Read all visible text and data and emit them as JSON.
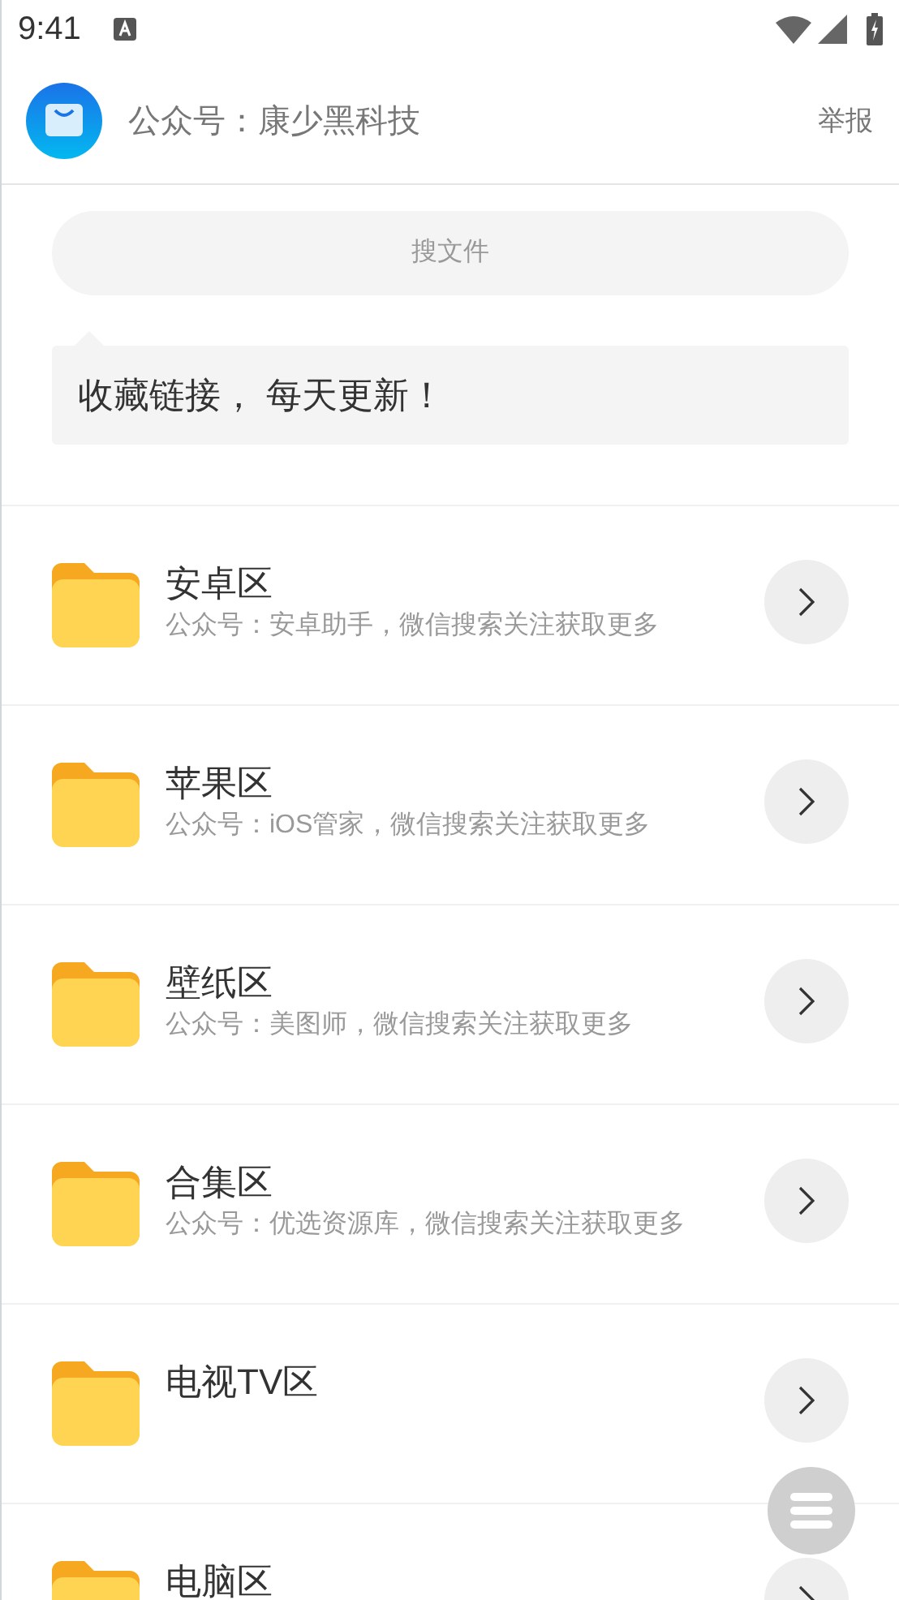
{
  "status_bar": {
    "time": "9:41"
  },
  "header": {
    "title": "公众号：康少黑科技",
    "report": "举报"
  },
  "search": {
    "placeholder": "搜文件"
  },
  "tip": "收藏链接， 每天更新！",
  "folders": [
    {
      "title": "安卓区",
      "subtitle": "公众号：安卓助手，微信搜索关注获取更多"
    },
    {
      "title": "苹果区",
      "subtitle": "公众号：iOS管家，微信搜索关注获取更多"
    },
    {
      "title": "壁纸区",
      "subtitle": "公众号：美图师，微信搜索关注获取更多"
    },
    {
      "title": "合集区",
      "subtitle": "公众号：优选资源库，微信搜索关注获取更多"
    },
    {
      "title": "电视TV区"
    },
    {
      "title": "电脑区"
    }
  ]
}
